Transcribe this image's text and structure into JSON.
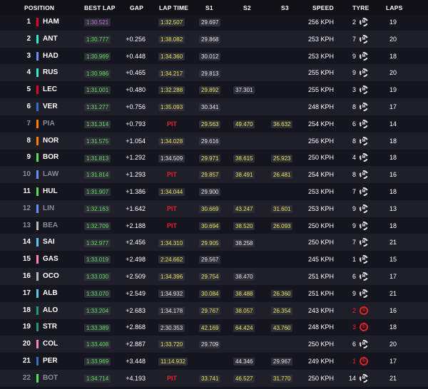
{
  "columns": {
    "position": "POSITION",
    "best_lap": "BEST LAP",
    "gap": "GAP",
    "lap_time": "LAP TIME",
    "s1": "S1",
    "s2": "S2",
    "s3": "S3",
    "speed": "SPEED",
    "tyre": "TYRE",
    "laps": "LAPS"
  },
  "colors": {
    "best_green": "#5fe15a",
    "overall_purple": "#c96be8",
    "personal_yellow": "#e9e35a",
    "pit_red": "#e8212a"
  },
  "rows": [
    {
      "pos": "1",
      "code": "HAM",
      "team": "#e8002d",
      "best": "1:30.521",
      "best_c": "purple",
      "gap": "",
      "lap": "1:32.507",
      "lap_c": "yellow",
      "s1": "29.697",
      "s1_c": "white",
      "s2": "",
      "s2_c": "",
      "s3": "",
      "s3_c": "",
      "speed": "256 KPH",
      "tyre": "2",
      "compound": "M",
      "tyre_icon": "medium-tyre-icon",
      "laps": "19",
      "dim": false
    },
    {
      "pos": "2",
      "code": "ANT",
      "team": "#27f4d2",
      "best": "1:30.777",
      "best_c": "green",
      "gap": "+0.256",
      "lap": "1:38.082",
      "lap_c": "yellow",
      "s1": "29.868",
      "s1_c": "white",
      "s2": "",
      "s2_c": "",
      "s3": "",
      "s3_c": "",
      "speed": "253 KPH",
      "tyre": "7",
      "compound": "M",
      "tyre_icon": "medium-tyre-icon",
      "laps": "20",
      "dim": false
    },
    {
      "pos": "3",
      "code": "HAD",
      "team": "#6692ff",
      "best": "1:30.969",
      "best_c": "green",
      "gap": "+0.448",
      "lap": "1:34.360",
      "lap_c": "yellow",
      "s1": "30.012",
      "s1_c": "white",
      "s2": "",
      "s2_c": "",
      "s3": "",
      "s3_c": "",
      "speed": "253 KPH",
      "tyre": "9",
      "compound": "M",
      "tyre_icon": "medium-tyre-icon",
      "laps": "18",
      "dim": false
    },
    {
      "pos": "4",
      "code": "RUS",
      "team": "#27f4d2",
      "best": "1:30.986",
      "best_c": "green",
      "gap": "+0.465",
      "lap": "1:34.217",
      "lap_c": "yellow",
      "s1": "29.813",
      "s1_c": "white",
      "s2": "",
      "s2_c": "",
      "s3": "",
      "s3_c": "",
      "speed": "255 KPH",
      "tyre": "9",
      "compound": "M",
      "tyre_icon": "medium-tyre-icon",
      "laps": "20",
      "dim": false
    },
    {
      "pos": "5",
      "code": "LEC",
      "team": "#e8002d",
      "best": "1:31.001",
      "best_c": "green",
      "gap": "+0.480",
      "lap": "1:32.288",
      "lap_c": "yellow",
      "s1": "29.892",
      "s1_c": "yellow",
      "s2": "37.301",
      "s2_c": "white",
      "s3": "",
      "s3_c": "",
      "speed": "255 KPH",
      "tyre": "3",
      "compound": "M",
      "tyre_icon": "medium-tyre-icon",
      "laps": "19",
      "dim": false
    },
    {
      "pos": "6",
      "code": "VER",
      "team": "#3671c6",
      "best": "1:31.277",
      "best_c": "green",
      "gap": "+0.756",
      "lap": "1:35.093",
      "lap_c": "yellow",
      "s1": "30.341",
      "s1_c": "white",
      "s2": "",
      "s2_c": "",
      "s3": "",
      "s3_c": "",
      "speed": "248 KPH",
      "tyre": "8",
      "compound": "M",
      "tyre_icon": "medium-tyre-icon",
      "laps": "17",
      "dim": false
    },
    {
      "pos": "7",
      "code": "PIA",
      "team": "#ff8000",
      "best": "1:31.314",
      "best_c": "green",
      "gap": "+0.793",
      "lap": "PIT",
      "lap_c": "pit",
      "s1": "29.563",
      "s1_c": "yellow",
      "s2": "49.470",
      "s2_c": "yellow",
      "s3": "36.632",
      "s3_c": "yellow",
      "speed": "254 KPH",
      "tyre": "6",
      "compound": "M",
      "tyre_icon": "medium-tyre-icon",
      "laps": "14",
      "dim": true
    },
    {
      "pos": "8",
      "code": "NOR",
      "team": "#ff8000",
      "best": "1:31.575",
      "best_c": "green",
      "gap": "+1.054",
      "lap": "1:34.028",
      "lap_c": "yellow",
      "s1": "29.616",
      "s1_c": "white",
      "s2": "",
      "s2_c": "",
      "s3": "",
      "s3_c": "",
      "speed": "256 KPH",
      "tyre": "8",
      "compound": "M",
      "tyre_icon": "medium-tyre-icon",
      "laps": "18",
      "dim": false
    },
    {
      "pos": "9",
      "code": "BOR",
      "team": "#52e252",
      "best": "1:31.813",
      "best_c": "green",
      "gap": "+1.292",
      "lap": "1:34.509",
      "lap_c": "white",
      "s1": "29.971",
      "s1_c": "yellow",
      "s2": "38.615",
      "s2_c": "yellow",
      "s3": "25.923",
      "s3_c": "yellow",
      "speed": "250 KPH",
      "tyre": "4",
      "compound": "M",
      "tyre_icon": "medium-tyre-icon",
      "laps": "18",
      "dim": false
    },
    {
      "pos": "10",
      "code": "LAW",
      "team": "#6692ff",
      "best": "1:31.814",
      "best_c": "green",
      "gap": "+1.293",
      "lap": "PIT",
      "lap_c": "pit",
      "s1": "29.857",
      "s1_c": "yellow",
      "s2": "38.491",
      "s2_c": "yellow",
      "s3": "26.481",
      "s3_c": "yellow",
      "speed": "254 KPH",
      "tyre": "8",
      "compound": "M",
      "tyre_icon": "medium-tyre-icon",
      "laps": "16",
      "dim": true
    },
    {
      "pos": "11",
      "code": "HUL",
      "team": "#52e252",
      "best": "1:31.907",
      "best_c": "green",
      "gap": "+1.386",
      "lap": "1:34.044",
      "lap_c": "yellow",
      "s1": "29.900",
      "s1_c": "white",
      "s2": "",
      "s2_c": "",
      "s3": "",
      "s3_c": "",
      "speed": "253 KPH",
      "tyre": "7",
      "compound": "M",
      "tyre_icon": "medium-tyre-icon",
      "laps": "18",
      "dim": false
    },
    {
      "pos": "12",
      "code": "LIN",
      "team": "#6692ff",
      "best": "1:32.163",
      "best_c": "green",
      "gap": "+1.642",
      "lap": "PIT",
      "lap_c": "pit",
      "s1": "30.669",
      "s1_c": "yellow",
      "s2": "43.247",
      "s2_c": "yellow",
      "s3": "31.601",
      "s3_c": "yellow",
      "speed": "253 KPH",
      "tyre": "9",
      "compound": "M",
      "tyre_icon": "medium-tyre-icon",
      "laps": "13",
      "dim": true
    },
    {
      "pos": "13",
      "code": "BEA",
      "team": "#b6babd",
      "best": "1:32.709",
      "best_c": "green",
      "gap": "+2.188",
      "lap": "PIT",
      "lap_c": "pit",
      "s1": "30.694",
      "s1_c": "yellow",
      "s2": "38.520",
      "s2_c": "yellow",
      "s3": "26.093",
      "s3_c": "yellow",
      "speed": "250 KPH",
      "tyre": "9",
      "compound": "M",
      "tyre_icon": "medium-tyre-icon",
      "laps": "18",
      "dim": true
    },
    {
      "pos": "14",
      "code": "SAI",
      "team": "#64c4ff",
      "best": "1:32.977",
      "best_c": "green",
      "gap": "+2.456",
      "lap": "1:34.310",
      "lap_c": "yellow",
      "s1": "29.905",
      "s1_c": "yellow",
      "s2": "38.258",
      "s2_c": "white",
      "s3": "",
      "s3_c": "",
      "speed": "250 KPH",
      "tyre": "7",
      "compound": "M",
      "tyre_icon": "medium-tyre-icon",
      "laps": "21",
      "dim": false
    },
    {
      "pos": "15",
      "code": "GAS",
      "team": "#ff87bc",
      "best": "1:33.019",
      "best_c": "green",
      "gap": "+2.498",
      "lap": "2:24.662",
      "lap_c": "yellow",
      "s1": "29.567",
      "s1_c": "white",
      "s2": "",
      "s2_c": "",
      "s3": "",
      "s3_c": "",
      "speed": "245 KPH",
      "tyre": "1",
      "compound": "M",
      "tyre_icon": "medium-tyre-icon",
      "laps": "15",
      "dim": false
    },
    {
      "pos": "16",
      "code": "OCO",
      "team": "#b6babd",
      "best": "1:33.030",
      "best_c": "green",
      "gap": "+2.509",
      "lap": "1:34.396",
      "lap_c": "yellow",
      "s1": "29.754",
      "s1_c": "yellow",
      "s2": "38.470",
      "s2_c": "white",
      "s3": "",
      "s3_c": "",
      "speed": "251 KPH",
      "tyre": "6",
      "compound": "M",
      "tyre_icon": "medium-tyre-icon",
      "laps": "17",
      "dim": false
    },
    {
      "pos": "17",
      "code": "ALB",
      "team": "#64c4ff",
      "best": "1:33.070",
      "best_c": "green",
      "gap": "+2.549",
      "lap": "1:34.932",
      "lap_c": "white",
      "s1": "30.084",
      "s1_c": "yellow",
      "s2": "38.488",
      "s2_c": "yellow",
      "s3": "26.360",
      "s3_c": "yellow",
      "speed": "251 KPH",
      "tyre": "9",
      "compound": "M",
      "tyre_icon": "medium-tyre-icon",
      "laps": "21",
      "dim": false
    },
    {
      "pos": "18",
      "code": "ALO",
      "team": "#229971",
      "best": "1:33.204",
      "best_c": "green",
      "gap": "+2.683",
      "lap": "1:34.178",
      "lap_c": "white",
      "s1": "29.767",
      "s1_c": "yellow",
      "s2": "38.057",
      "s2_c": "yellow",
      "s3": "26.354",
      "s3_c": "yellow",
      "speed": "243 KPH",
      "tyre": "2",
      "compound": "S",
      "tyre_icon": "soft-tyre-icon",
      "laps": "16",
      "dim": false
    },
    {
      "pos": "19",
      "code": "STR",
      "team": "#229971",
      "best": "1:33.389",
      "best_c": "green",
      "gap": "+2.868",
      "lap": "2:30.353",
      "lap_c": "white",
      "s1": "42.169",
      "s1_c": "yellow",
      "s2": "64.424",
      "s2_c": "yellow",
      "s3": "43.760",
      "s3_c": "yellow",
      "speed": "248 KPH",
      "tyre": "3",
      "compound": "S",
      "tyre_icon": "soft-tyre-icon",
      "laps": "18",
      "dim": false
    },
    {
      "pos": "20",
      "code": "COL",
      "team": "#ff87bc",
      "best": "1:33.408",
      "best_c": "green",
      "gap": "+2.887",
      "lap": "1:33.720",
      "lap_c": "yellow",
      "s1": "29.709",
      "s1_c": "white",
      "s2": "",
      "s2_c": "",
      "s3": "",
      "s3_c": "",
      "speed": "250 KPH",
      "tyre": "6",
      "compound": "M",
      "tyre_icon": "medium-tyre-icon",
      "laps": "20",
      "dim": false
    },
    {
      "pos": "21",
      "code": "PER",
      "team": "#3671c6",
      "best": "1:33.969",
      "best_c": "green",
      "gap": "+3.448",
      "lap": "11:14.932",
      "lap_c": "yellow",
      "s1": "",
      "s1_c": "",
      "s2": "44.346",
      "s2_c": "white",
      "s3": "29.967",
      "s3_c": "white",
      "speed": "249 KPH",
      "tyre": "1",
      "compound": "S",
      "tyre_icon": "soft-tyre-icon",
      "laps": "17",
      "dim": false
    },
    {
      "pos": "22",
      "code": "BOT",
      "team": "#52e252",
      "best": "1:34.714",
      "best_c": "green",
      "gap": "+4.193",
      "lap": "PIT",
      "lap_c": "pit",
      "s1": "33.741",
      "s1_c": "yellow",
      "s2": "46.527",
      "s2_c": "yellow",
      "s3": "31.770",
      "s3_c": "yellow",
      "speed": "250 KPH",
      "tyre": "14",
      "compound": "M",
      "tyre_icon": "medium-tyre-icon",
      "laps": "21",
      "dim": true
    }
  ]
}
